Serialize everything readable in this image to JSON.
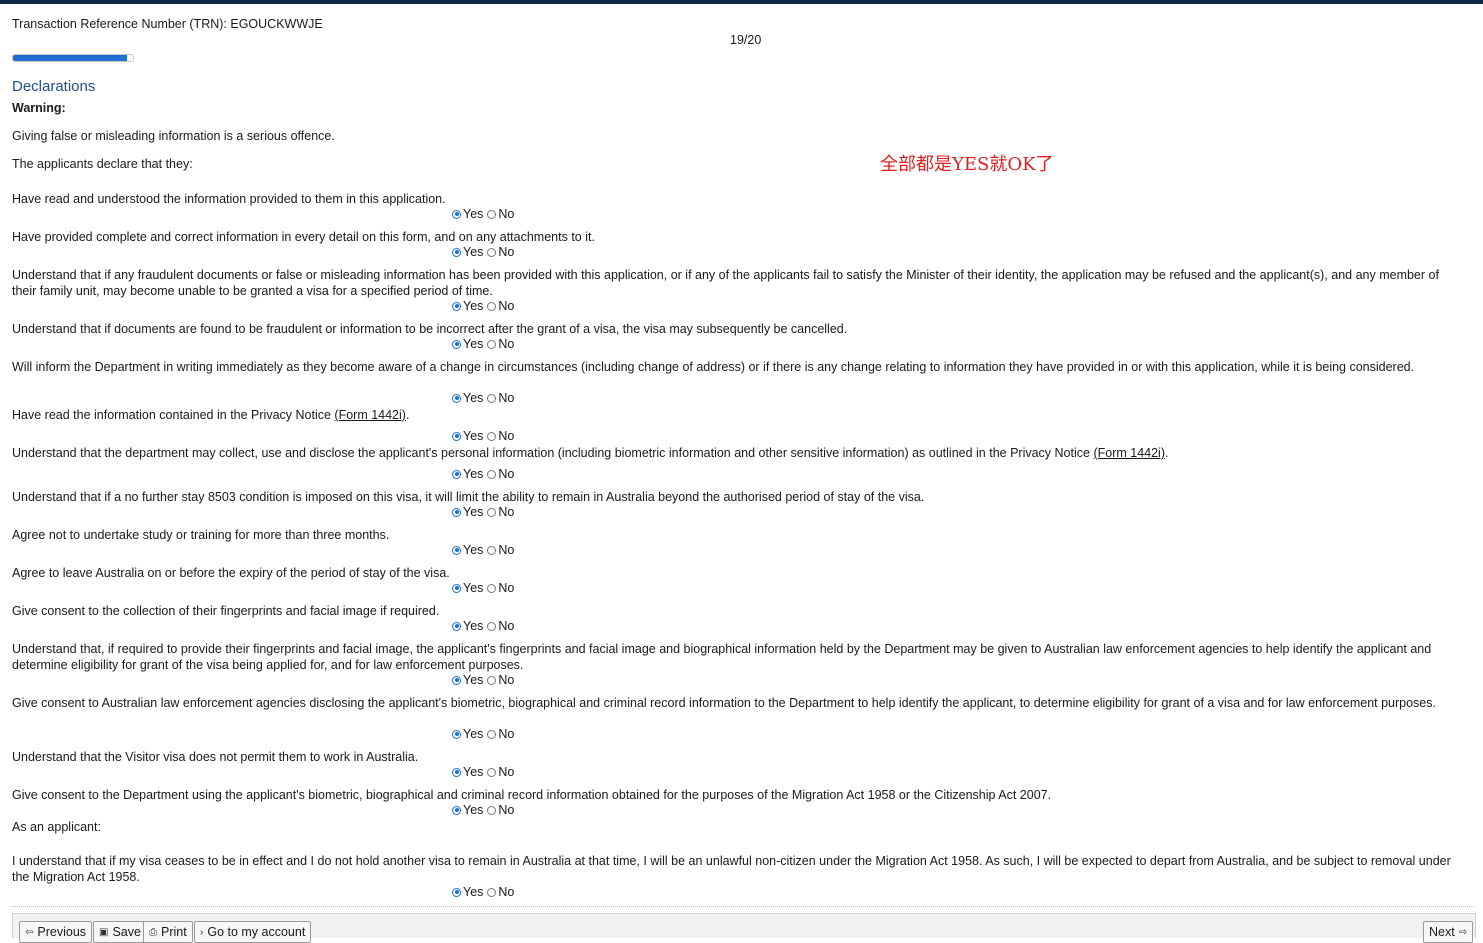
{
  "header": {
    "trn_label": "Transaction Reference Number (TRN): EGOUCKWWJE",
    "page_counter": "19/20",
    "progress_fraction": 0.95
  },
  "section": {
    "title": "Declarations",
    "warning_label": "Warning:",
    "warning_text": "Giving false or misleading information is a serious offence.",
    "intro": "The applicants declare that they:",
    "as_applicant": "As an applicant:"
  },
  "annotation": "全部都是YES就OK了",
  "options": {
    "yes": "Yes",
    "no": "No"
  },
  "questions": [
    {
      "text": "Have read and understood the information provided to them in this application.",
      "answer": "Yes"
    },
    {
      "text": "Have provided complete and correct information in every detail on this form, and on any attachments to it.",
      "answer": "Yes"
    },
    {
      "text": "Understand that if any fraudulent documents or false or misleading information has been provided with this application, or if any of the applicants fail to satisfy the Minister of their identity, the application may be refused and the applicant(s), and any member of their family unit, may become unable to be granted a visa for a specified period of time.",
      "answer": "Yes"
    },
    {
      "text": "Understand that if documents are found to be fraudulent or information to be incorrect after the grant of a visa, the visa may subsequently be cancelled.",
      "answer": "Yes"
    },
    {
      "text": "Will inform the Department in writing immediately as they become aware of a change in circumstances (including change of address) or if there is any change relating to information they have provided in or with this application, while it is being considered.",
      "answer": "Yes"
    },
    {
      "text": "Have read the information contained in the Privacy Notice ",
      "link": "(Form 1442i)",
      "suffix": ".",
      "answer": "Yes"
    },
    {
      "text": "Understand that the department may collect, use and disclose the applicant's personal information (including biometric information and other sensitive information) as outlined in the Privacy Notice ",
      "link": "(Form 1442i)",
      "suffix": ".",
      "answer": "Yes"
    },
    {
      "text": "Understand that if a no further stay 8503 condition is imposed on this visa, it will limit the ability to remain in Australia beyond the authorised period of stay of the visa.",
      "answer": "Yes"
    },
    {
      "text": "Agree not to undertake study or training for more than three months.",
      "answer": "Yes"
    },
    {
      "text": "Agree to leave Australia on or before the expiry of the period of stay of the visa.",
      "answer": "Yes"
    },
    {
      "text": "Give consent to the collection of their fingerprints and facial image if required.",
      "answer": "Yes"
    },
    {
      "text": "Understand that, if required to provide their fingerprints and facial image, the applicant's fingerprints and facial image and biographical information held by the Department may be given to Australian law enforcement agencies to help identify the applicant and determine eligibility for grant of the visa being applied for, and for law enforcement purposes.",
      "answer": "Yes"
    },
    {
      "text": "Give consent to Australian law enforcement agencies disclosing the applicant's biometric, biographical and criminal record information to the Department to help identify the applicant, to determine eligibility for grant of a visa and for law enforcement purposes.",
      "answer": "Yes"
    },
    {
      "text": "Understand that the Visitor visa does not permit them to work in Australia.",
      "answer": "Yes"
    },
    {
      "text": "Give consent to the Department using the applicant's biometric, biographical and criminal record information obtained for the purposes of the Migration Act 1958 or the Citizenship Act 2007.",
      "answer": "Yes"
    },
    {
      "text": "I understand that if my visa ceases to be in effect and I do not hold another visa to remain in Australia at that time, I will be an unlawful non-citizen under the Migration Act 1958. As such, I will be expected to depart from Australia, and be subject to removal under the Migration Act 1958.",
      "answer": "Yes"
    }
  ],
  "buttons": {
    "previous": "Previous",
    "save": "Save",
    "print": "Print",
    "account": "Go to my account",
    "next": "Next"
  },
  "icons": {
    "previous": "arrow-left-icon",
    "save": "floppy-disk-icon",
    "print": "printer-icon",
    "account": "chevron-right-icon",
    "next": "arrow-right-icon"
  }
}
